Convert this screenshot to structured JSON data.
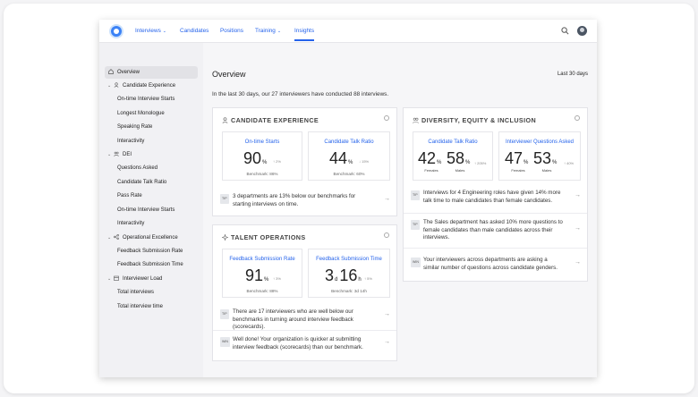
{
  "nav": {
    "interviews": "Interviews",
    "candidates": "Candidates",
    "positions": "Positions",
    "training": "Training",
    "insights": "Insights"
  },
  "sidebar": {
    "overview": "Overview",
    "candidate_experience": "Candidate Experience",
    "ce_items": [
      "On-time Interview Starts",
      "Longest Monologue",
      "Speaking Rate",
      "Interactivity"
    ],
    "dei": "DEI",
    "dei_items": [
      "Questions Asked",
      "Candidate Talk Ratio",
      "Pass Rate",
      "On-time Interview Starts",
      "Interactivity"
    ],
    "operational_excellence": "Operational Excellence",
    "oe_items": [
      "Feedback Submission Rate",
      "Feedback Submission Time"
    ],
    "interviewer_load": "Interviewer Load",
    "il_items": [
      "Total interviews",
      "Total interview time"
    ]
  },
  "main": {
    "title": "Overview",
    "period": "Last 30 days",
    "subtitle": "In the last 30 days, our 27 interviewers have conducted 88 interviews."
  },
  "candidate_experience": {
    "title": "CANDIDATE EXPERIENCE",
    "m1": {
      "title": "On-time Starts",
      "value": "90",
      "unit": "%",
      "delta": "↑ 2%",
      "bench": "Benchmark: 86%"
    },
    "m2": {
      "title": "Candidate Talk Ratio",
      "value": "44",
      "unit": "%",
      "delta": "↓ 15%",
      "bench": "Benchmark: 60%"
    },
    "tip_badge": "TIP",
    "tip": "3 departments are 13% below our benchmarks for starting interviews on time."
  },
  "talent_operations": {
    "title": "TALENT OPERATIONS",
    "m1": {
      "title": "Feedback Submission Rate",
      "value": "91",
      "unit": "%",
      "delta": "↑ 3%",
      "bench": "Benchmark: 88%"
    },
    "m2": {
      "title": "Feedback Submission Time",
      "v1": "3",
      "u1": "d",
      "v2": "16",
      "u2": "h",
      "delta": "↑ 5%",
      "bench": "Benchmark: 3d 14h"
    },
    "tip_badge": "TIP",
    "tip": "There are 17 interviewers who are well below our benchmarks in turning around interview feedback (scorecards).",
    "win_badge": "WIN",
    "win": "Well done! Your organization is quicker at submitting interview feedback (scorecards) than our benchmark."
  },
  "dei": {
    "title": "DIVERSITY, EQUITY & INCLUSION",
    "m1": {
      "title": "Candidate Talk Ratio",
      "v1": "42",
      "u1": "%",
      "l1": "Females",
      "v2": "58",
      "u2": "%",
      "l2": "Males",
      "delta": "↑ 205%"
    },
    "m2": {
      "title": "Interviewer Questions Asked",
      "v1": "47",
      "u1": "%",
      "l1": "Females",
      "v2": "53",
      "u2": "%",
      "l2": "Males",
      "delta": "↑ 40%"
    },
    "tip1_badge": "TIP",
    "tip1": "Interviews for 4 Engineering roles have given 14% more talk time to male candidates than female candidates.",
    "tip2_badge": "TIP",
    "tip2": "The Sales department has asked 10% more questions to female candidates than male candidates across their interviews.",
    "win_badge": "WIN",
    "win": "Your interviewers across departments are asking a similar number of questions across candidate genders."
  }
}
